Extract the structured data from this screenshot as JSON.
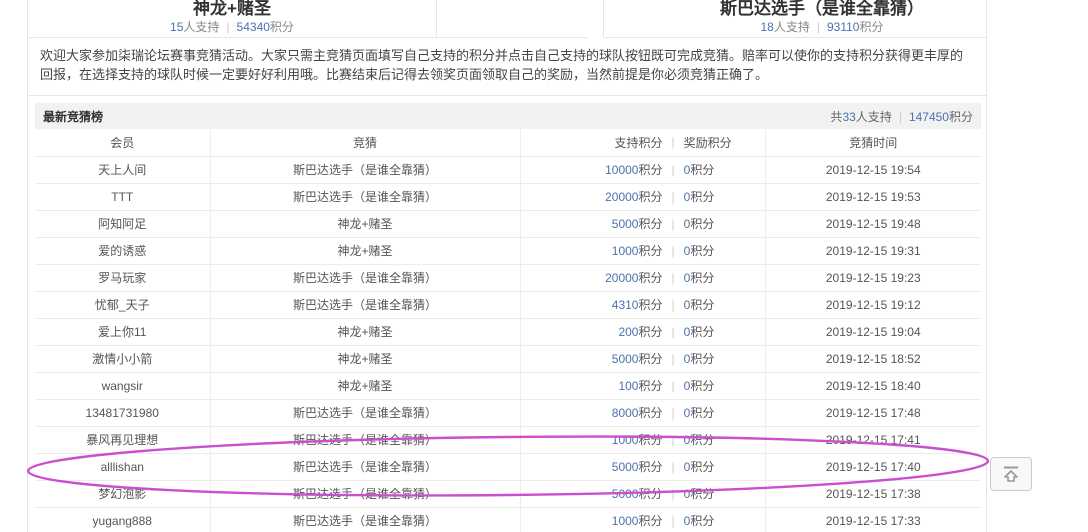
{
  "sep": "|",
  "header": {
    "teams": [
      {
        "name": "神龙+赌圣",
        "supporters_num": "15",
        "supporters_label": "人支持",
        "points_num": "54340",
        "points_label": "积分"
      },
      {
        "name": "斯巴达选手（是谁全靠猜）",
        "supporters_num": "18",
        "supporters_label": "人支持",
        "points_num": "93110",
        "points_label": "积分"
      }
    ]
  },
  "notice": "欢迎大家参加柒瑞论坛赛事竞猜活动。大家只需主竞猜页面填写自己支持的积分并点击自己支持的球队按钮既可完成竞猜。赔率可以使你的支持积分获得更丰厚的回报，在选择支持的球队时候一定要好好利用哦。比赛结束后记得去领奖页面领取自己的奖励，当然前提是你必须竞猜正确了。",
  "board": {
    "title": "最新竞猜榜",
    "total_prefix": "共",
    "total_num": "33",
    "total_suffix": "人支持",
    "total_points_num": "147450",
    "total_points_suffix": "积分"
  },
  "table": {
    "headers": {
      "member": "会员",
      "guess": "竞猜",
      "support": "支持积分",
      "reward": "奖励积分",
      "time": "竞猜时间"
    },
    "points_unit": "积分",
    "rows": [
      {
        "member": "天上人间",
        "guess": "斯巴达选手（是谁全靠猜）",
        "support": "10000",
        "reward": "0",
        "time": "2019-12-15 19:54"
      },
      {
        "member": "TTT",
        "guess": "斯巴达选手（是谁全靠猜）",
        "support": "20000",
        "reward": "0",
        "time": "2019-12-15 19:53"
      },
      {
        "member": "阿知阿足",
        "guess": "神龙+赌圣",
        "support": "5000",
        "reward": "0",
        "time": "2019-12-15 19:48"
      },
      {
        "member": "爱的诱惑",
        "guess": "神龙+赌圣",
        "support": "1000",
        "reward": "0",
        "time": "2019-12-15 19:31"
      },
      {
        "member": "罗马玩家",
        "guess": "斯巴达选手（是谁全靠猜）",
        "support": "20000",
        "reward": "0",
        "time": "2019-12-15 19:23"
      },
      {
        "member": "忧郁_天子",
        "guess": "斯巴达选手（是谁全靠猜）",
        "support": "4310",
        "reward": "0",
        "time": "2019-12-15 19:12"
      },
      {
        "member": "爱上你11",
        "guess": "神龙+赌圣",
        "support": "200",
        "reward": "0",
        "time": "2019-12-15 19:04"
      },
      {
        "member": "激情小小箭",
        "guess": "神龙+赌圣",
        "support": "5000",
        "reward": "0",
        "time": "2019-12-15 18:52"
      },
      {
        "member": "wangsir",
        "guess": "神龙+赌圣",
        "support": "100",
        "reward": "0",
        "time": "2019-12-15 18:40"
      },
      {
        "member": "13481731980",
        "guess": "斯巴达选手（是谁全靠猜）",
        "support": "8000",
        "reward": "0",
        "time": "2019-12-15 17:48"
      },
      {
        "member": "暴风再见理想",
        "guess": "斯巴达选手（是谁全靠猜）",
        "support": "1000",
        "reward": "0",
        "time": "2019-12-15 17:41"
      },
      {
        "member": "alllishan",
        "guess": "斯巴达选手（是谁全靠猜）",
        "support": "5000",
        "reward": "0",
        "time": "2019-12-15 17:40"
      },
      {
        "member": "梦幻泡影",
        "guess": "斯巴达选手（是谁全靠猜）",
        "support": "5000",
        "reward": "0",
        "time": "2019-12-15 17:38"
      },
      {
        "member": "yugang888",
        "guess": "斯巴达选手（是谁全靠猜）",
        "support": "1000",
        "reward": "0",
        "time": "2019-12-15 17:33"
      }
    ]
  },
  "annotation": {
    "shape": "ellipse-highlight",
    "highlighted_member": "alllishan",
    "highlighted_row_index": 11,
    "color": "#c94fd0"
  },
  "icons": {
    "scroll_top": "scroll-top-icon"
  },
  "colors": {
    "accent_number": "#4a72ad",
    "annotation": "#c94fd0",
    "bar_bg": "#f2f2f2",
    "border": "#e6e6e6"
  }
}
